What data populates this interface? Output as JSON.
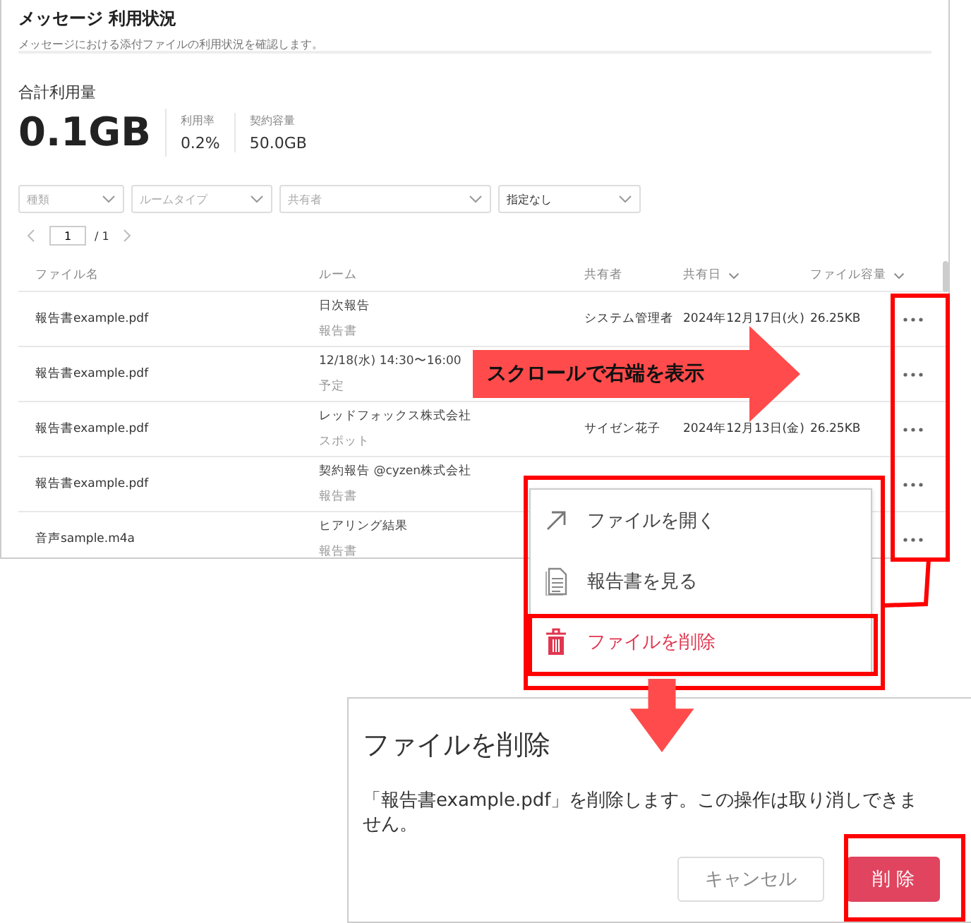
{
  "page": {
    "title": "メッセージ 利用状況",
    "description": "メッセージにおける添付ファイルの利用状況を確認します。"
  },
  "usage": {
    "label": "合計利用量",
    "total": "0.1GB",
    "stats": [
      {
        "label": "利用率",
        "value": "0.2%"
      },
      {
        "label": "契約容量",
        "value": "50.0GB"
      }
    ]
  },
  "filters": [
    {
      "placeholder": "種類"
    },
    {
      "placeholder": "ルームタイプ"
    },
    {
      "placeholder": "共有者"
    },
    {
      "value": "指定なし"
    }
  ],
  "pagination": {
    "page": "1",
    "total": "/ 1"
  },
  "table": {
    "columns": [
      {
        "label": "ファイル名",
        "sortable": false
      },
      {
        "label": "ルーム",
        "sortable": false
      },
      {
        "label": "共有者",
        "sortable": false
      },
      {
        "label": "共有日",
        "sortable": true
      },
      {
        "label": "ファイル容量",
        "sortable": true
      }
    ],
    "rows": [
      {
        "file": "報告書example.pdf",
        "room": "日次報告",
        "room_type": "報告書",
        "shared_by": "システム管理者",
        "shared_date": "2024年12月17日(火)",
        "size": "26.25KB"
      },
      {
        "file": "報告書example.pdf",
        "room": "12/18(水) 14:30〜16:00",
        "room_type": "予定"
      },
      {
        "file": "報告書example.pdf",
        "room": "レッドフォックス株式会社",
        "room_type": "スポット",
        "shared_by": "サイゼン花子",
        "shared_date": "2024年12月13日(金)",
        "size": "26.25KB"
      },
      {
        "file": "報告書example.pdf",
        "room": "契約報告 @cyzen株式会社",
        "room_type": "報告書"
      },
      {
        "file": "音声sample.m4a",
        "room": "ヒアリング結果",
        "room_type": "報告書"
      }
    ]
  },
  "menu": {
    "items": [
      {
        "kind": "open",
        "label": "ファイルを開く"
      },
      {
        "kind": "report",
        "label": "報告書を見る"
      },
      {
        "kind": "delete",
        "label": "ファイルを削除"
      }
    ]
  },
  "dialog": {
    "title": "ファイルを削除",
    "message": "「報告書example.pdf」を削除します。この操作は取り消しできません。",
    "buttons": [
      {
        "kind": "secondary",
        "label": "キャンセル"
      },
      {
        "kind": "danger",
        "label": "削 除"
      }
    ]
  },
  "annotations": {
    "scroll_hint": "スクロールで右端を表示"
  }
}
